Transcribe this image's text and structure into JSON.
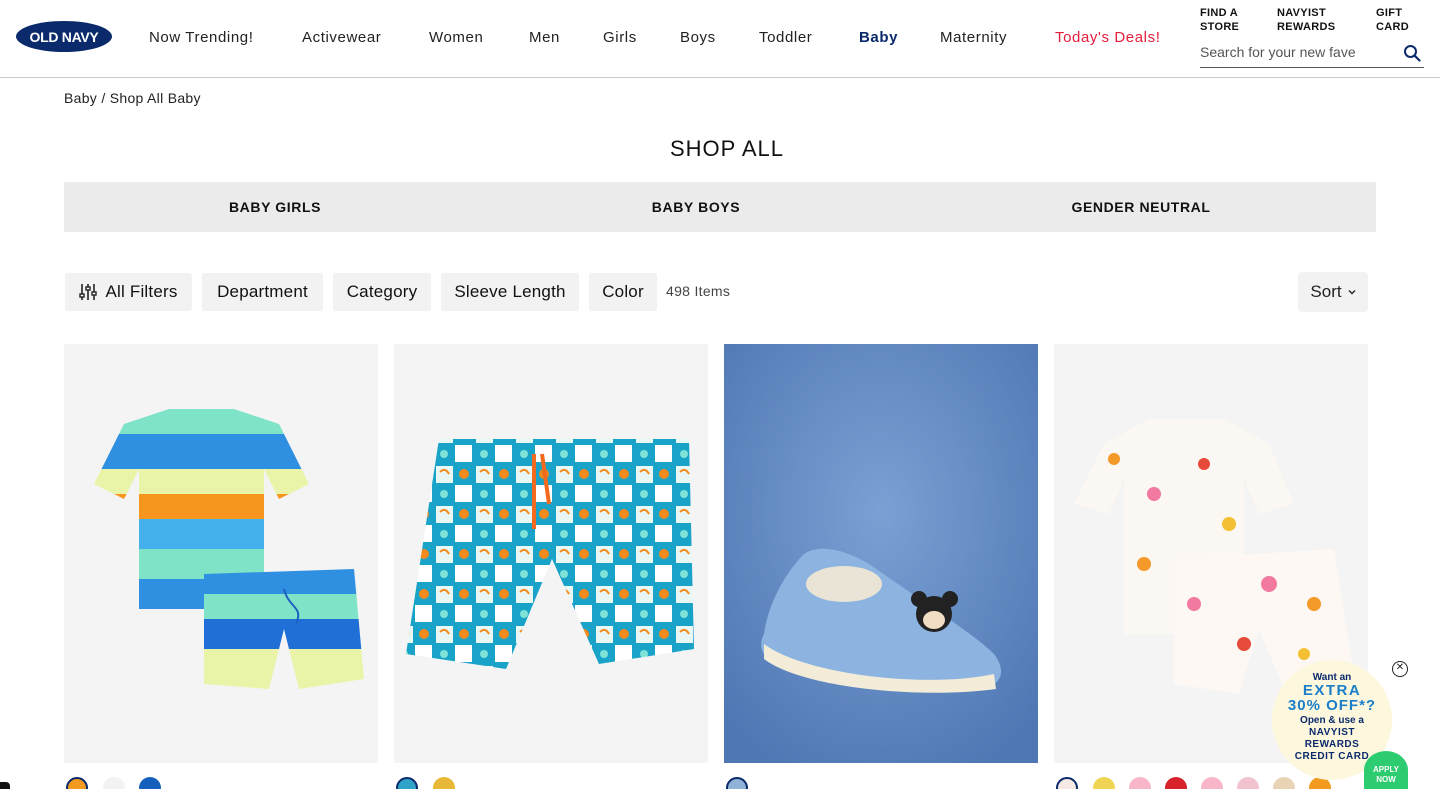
{
  "header": {
    "logo_text": "OLD NAVY",
    "nav": [
      {
        "label": "Now Trending!"
      },
      {
        "label": "Activewear"
      },
      {
        "label": "Women"
      },
      {
        "label": "Men"
      },
      {
        "label": "Girls"
      },
      {
        "label": "Boys"
      },
      {
        "label": "Toddler"
      },
      {
        "label": "Baby",
        "active": true
      },
      {
        "label": "Maternity"
      },
      {
        "label": "Today's Deals!"
      }
    ],
    "utility": {
      "find_store": "FIND A\nSTORE",
      "navyist_rewards": "NAVYIST\nREWARDS",
      "gift_card": "GIFT\nCARD"
    },
    "search": {
      "placeholder": "Search for your new fave",
      "value": ""
    },
    "brand_color": "#0a2a6b",
    "deals_color": "#e41d3d"
  },
  "breadcrumb": {
    "items": [
      "Baby",
      "Shop All Baby"
    ],
    "separator": "/"
  },
  "page_title": "SHOP ALL",
  "segments": [
    "BABY GIRLS",
    "BABY BOYS",
    "GENDER NEUTRAL"
  ],
  "filters": {
    "chips": [
      "All Filters",
      "Department",
      "Category",
      "Sleeve Length",
      "Color"
    ],
    "item_count": "498 Items",
    "sort_label": "Sort"
  },
  "products": [
    {
      "image": "striped polo shirt and shorts set",
      "background": "#f4f4f4",
      "swatches": [
        "#f29b1f",
        "#f2f2f2",
        "#1560bd"
      ]
    },
    {
      "image": "printed swim trunks",
      "background": "#f4f4f4",
      "swatches": [
        "#2fa3c8",
        "#e8b838"
      ]
    },
    {
      "image": "Mickey Mouse slip-on shoes",
      "background": "#5f87bf",
      "swatches": [
        "#8fb2d6"
      ]
    },
    {
      "image": "printed short sleeve shirt and shorts set",
      "background": "#f4f4f4",
      "swatches": [
        "#f6e9e3",
        "#f0d555",
        "#f7b7c8",
        "#d8232a",
        "#f7b7c8",
        "#f3c2cf",
        "#e8d3b4",
        "#f29b1f"
      ]
    }
  ],
  "promo": {
    "line1": "Want an",
    "line2": "EXTRA",
    "line3": "30% OFF*?",
    "line4": "Open & use a",
    "line5": "NAVYIST",
    "line6": "REWARDS",
    "line7": "CREDIT CARD",
    "apply_line1": "APPLY",
    "apply_line2": "NOW",
    "close_glyph": "✕"
  }
}
